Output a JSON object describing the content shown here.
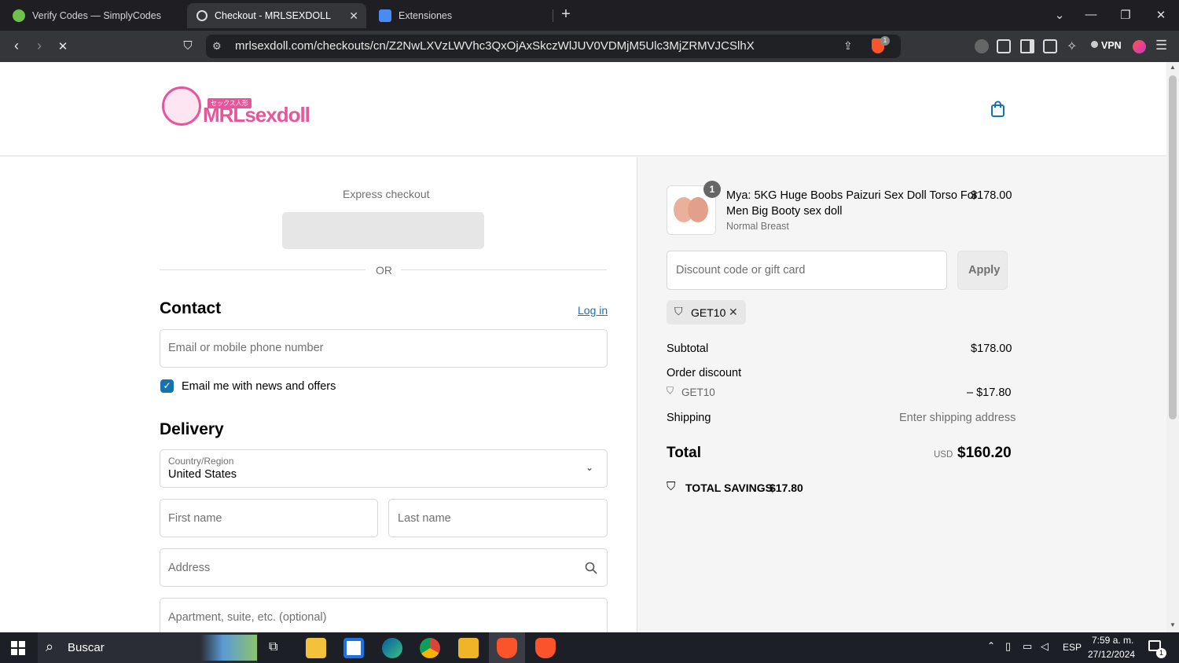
{
  "browser": {
    "tabs": [
      {
        "title": "Verify Codes — SimplyCodes",
        "active": false
      },
      {
        "title": "Checkout - MRLSEXDOLL",
        "active": true
      },
      {
        "title": "Extensiones",
        "active": false
      }
    ],
    "new_tab": "+",
    "url": "mrlsexdoll.com/checkouts/cn/Z2NwLXVzLWVhc3QxOjAxSkczWlJUV0VDMjM5Ulc3MjZRMVJCSlhX",
    "vpn_label": "VPN",
    "brave_badge": "1",
    "accent": "#1a73e8"
  },
  "store": {
    "logo_text": "MRLsexdoll",
    "logo_sub": "セックス人形",
    "brand_color": "#e8559a"
  },
  "checkout": {
    "express_label": "Express checkout",
    "or_label": "OR",
    "contact_title": "Contact",
    "login_link": "Log in",
    "email_placeholder": "Email or mobile phone number",
    "email_opt_in": "Email me with news and offers",
    "email_opt_in_checked": true,
    "delivery_title": "Delivery",
    "country_label": "Country/Region",
    "country_value": "United States",
    "first_name_placeholder": "First name",
    "last_name_placeholder": "Last name",
    "address_placeholder": "Address",
    "apartment_placeholder": "Apartment, suite, etc. (optional)"
  },
  "summary": {
    "item": {
      "qty": "1",
      "title_line1": "Mya: 5KG Huge Boobs Paizuri Sex Doll Torso For",
      "title_line2": "Men Big Booty sex doll",
      "variant": "Normal Breast",
      "price": "$178.00"
    },
    "discount_placeholder": "Discount code or gift card",
    "apply_label": "Apply",
    "applied_code": "GET10",
    "subtotal_label": "Subtotal",
    "subtotal_value": "$178.00",
    "order_discount_label": "Order discount",
    "discount_code": "GET10",
    "discount_value": "– $17.80",
    "shipping_label": "Shipping",
    "shipping_value": "Enter shipping address",
    "total_label": "Total",
    "currency": "USD",
    "total_value": "$160.20",
    "savings_label": "TOTAL SAVINGS",
    "savings_value": "$17.80"
  },
  "taskbar": {
    "search_label": "Buscar",
    "lang": "ESP",
    "time": "7:59 a. m.",
    "date": "27/12/2024",
    "notif_count": "1"
  }
}
